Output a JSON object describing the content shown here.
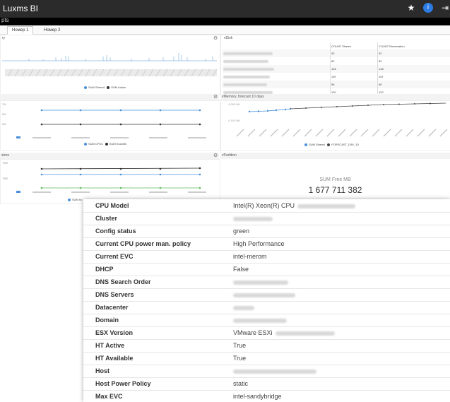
{
  "app": {
    "title": "Luxms BI",
    "subtitle": "pts"
  },
  "header_icons": {
    "star": "star-icon",
    "info": "info-icon",
    "logout": "logout-icon"
  },
  "tabs": [
    {
      "label": "Номер 1",
      "active": true
    },
    {
      "label": "Номер 2",
      "active": false
    }
  ],
  "panels": {
    "top_left": {
      "title": "ry",
      "legend": [
        "SUM Shared",
        "SUM Active"
      ]
    },
    "top_right": {
      "title": "vDisk",
      "columns": [
        "COUNT Shares",
        "COUNT Reservation"
      ],
      "rows": [
        [
          "92",
          "92"
        ],
        [
          "82",
          "82"
        ],
        [
          "148",
          "148"
        ],
        [
          "119",
          "119"
        ],
        [
          "96",
          "96"
        ],
        [
          "120",
          "120"
        ]
      ]
    },
    "mid_left": {
      "title": "",
      "y_ticks": [
        "7M",
        "5M",
        "5M"
      ],
      "legend": [
        "SUM CPUs",
        "SUM Sockets"
      ]
    },
    "mid_right": {
      "title": "vMemory, forecast 10 days",
      "y_ticks": [
        "4 265 5M",
        "4 140 5M"
      ],
      "legend": [
        "SUM Shared",
        "FORECAST_DAY_15"
      ]
    },
    "bottom_left": {
      "title": "store",
      "y_ticks": [
        "ТМЕ",
        "ТМЕ"
      ],
      "legend": [
        "SUM Ко"
      ]
    },
    "bottom_right": {
      "title": "vPartition",
      "summary_label": "SUM Free MB",
      "summary_value": "1 677 711 382"
    }
  },
  "colors": {
    "blue": "#4a90d9",
    "dark": "#333333",
    "green": "#5cb85c",
    "accent": "#2d7be5"
  },
  "properties": [
    {
      "key": "CPU Model",
      "value": "Intel(R) Xeon(R) CPU"
    },
    {
      "key": "Cluster",
      "value": ""
    },
    {
      "key": "Config status",
      "value": "green"
    },
    {
      "key": "Current CPU power man. policy",
      "value": "High Performance"
    },
    {
      "key": "Current EVC",
      "value": "intel-merom"
    },
    {
      "key": "DHCP",
      "value": "False"
    },
    {
      "key": "DNS Search Order",
      "value": ""
    },
    {
      "key": "DNS Servers",
      "value": ""
    },
    {
      "key": "Datacenter",
      "value": ""
    },
    {
      "key": "Domain",
      "value": ""
    },
    {
      "key": "ESX Version",
      "value": "VMware ESXi"
    },
    {
      "key": "HT Active",
      "value": "True"
    },
    {
      "key": "HT Available",
      "value": "True"
    },
    {
      "key": "Host",
      "value": ""
    },
    {
      "key": "Host Power Policy",
      "value": "static"
    },
    {
      "key": "Max EVC",
      "value": "intel-sandybridge"
    }
  ]
}
